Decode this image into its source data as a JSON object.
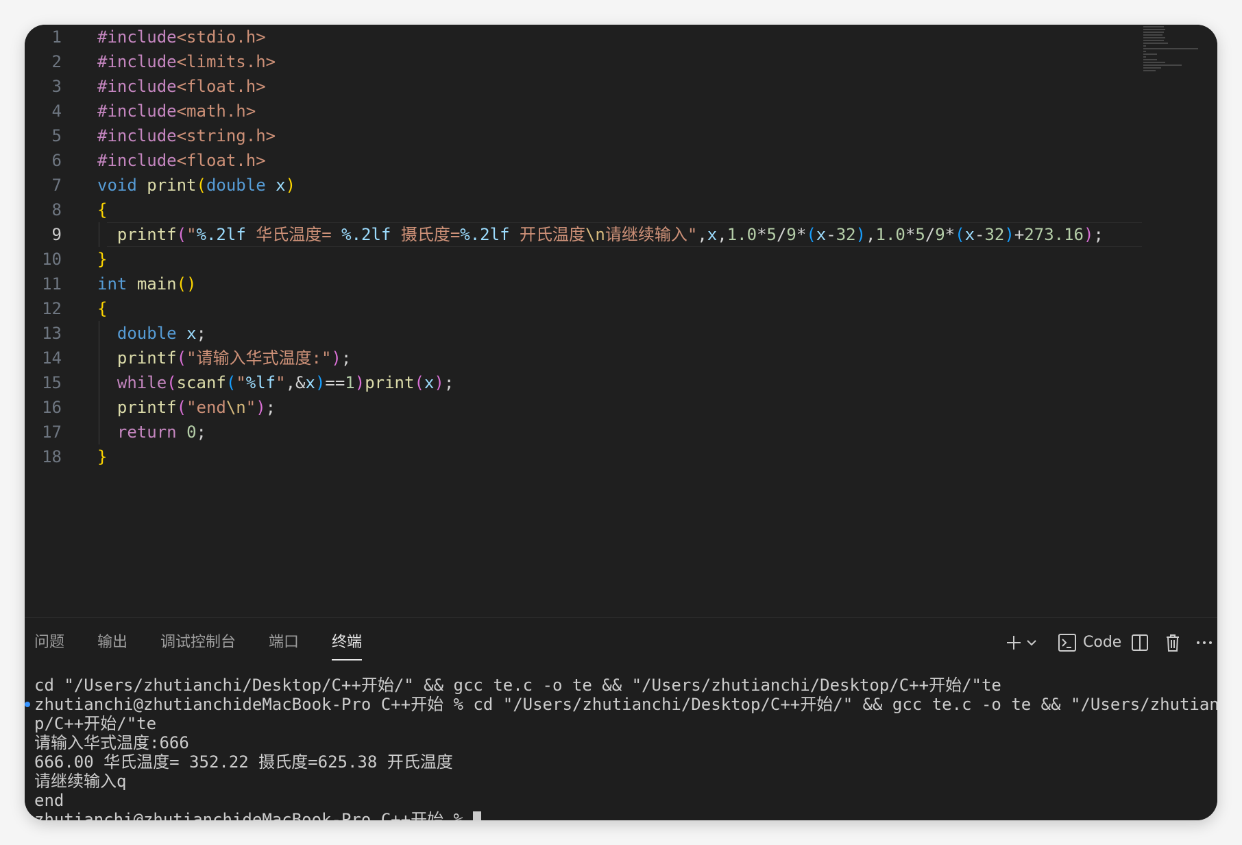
{
  "editor": {
    "current_line": 9,
    "lines": [
      {
        "num": "1",
        "code": "#include<stdio.h>"
      },
      {
        "num": "2",
        "code": "#include<limits.h>"
      },
      {
        "num": "3",
        "code": "#include<float.h>"
      },
      {
        "num": "4",
        "code": "#include<math.h>"
      },
      {
        "num": "5",
        "code": "#include<string.h>"
      },
      {
        "num": "6",
        "code": "#include<float.h>"
      },
      {
        "num": "7",
        "code": "void print(double x)"
      },
      {
        "num": "8",
        "code": "{"
      },
      {
        "num": "9",
        "code": "  printf(\"%.2lf 华氏温度= %.2lf 摄氏度=%.2lf 开氏温度\\n请继续输入\",x,1.0*5/9*(x-32),1.0*5/9*(x-32)+273.16);"
      },
      {
        "num": "10",
        "code": "}"
      },
      {
        "num": "11",
        "code": "int main()"
      },
      {
        "num": "12",
        "code": "{"
      },
      {
        "num": "13",
        "code": "  double x;"
      },
      {
        "num": "14",
        "code": "  printf(\"请输入华式温度:\");"
      },
      {
        "num": "15",
        "code": "  while(scanf(\"%lf\",&x)==1)print(x);"
      },
      {
        "num": "16",
        "code": "  printf(\"end\\n\");"
      },
      {
        "num": "17",
        "code": "  return 0;"
      },
      {
        "num": "18",
        "code": "}"
      }
    ]
  },
  "panel": {
    "tabs": [
      {
        "label": "问题"
      },
      {
        "label": "输出"
      },
      {
        "label": "调试控制台"
      },
      {
        "label": "端口"
      },
      {
        "label": "终端",
        "active": true
      }
    ],
    "actions": {
      "add_icon": "plus-icon",
      "dropdown_icon": "chevron-down-icon",
      "shell_icon": "terminal-icon",
      "shell_label": "Code",
      "split_icon": "split-icon",
      "trash_icon": "trash-icon",
      "more_icon": "ellipsis-icon"
    }
  },
  "terminal": {
    "lines": [
      "cd \"/Users/zhutianchi/Desktop/C++开始/\" && gcc te.c -o te && \"/Users/zhutianchi/Desktop/C++开始/\"te",
      "zhutianchi@zhutianchideMacBook-Pro C++开始 % cd \"/Users/zhutianchi/Desktop/C++开始/\" && gcc te.c -o te && \"/Users/zhutianchi/Deskto",
      "p/C++开始/\"te",
      "请输入华式温度:666",
      "666.00 华氏温度= 352.22 摄氏度=625.38 开氏温度",
      "请继续输入q",
      "end",
      "zhutianchi@zhutianchideMacBook-Pro C++开始 % "
    ]
  },
  "colors": {
    "window_bg": "#1e1e1e",
    "preprocessor": "#c586c0",
    "keyword": "#569cd6",
    "function": "#dcdcaa",
    "variable": "#9cdcfe",
    "string": "#ce9178",
    "number": "#b5cea8",
    "bracket_level1": "#ffd700",
    "bracket_level2": "#da70d6",
    "bracket_level3": "#179fff"
  }
}
